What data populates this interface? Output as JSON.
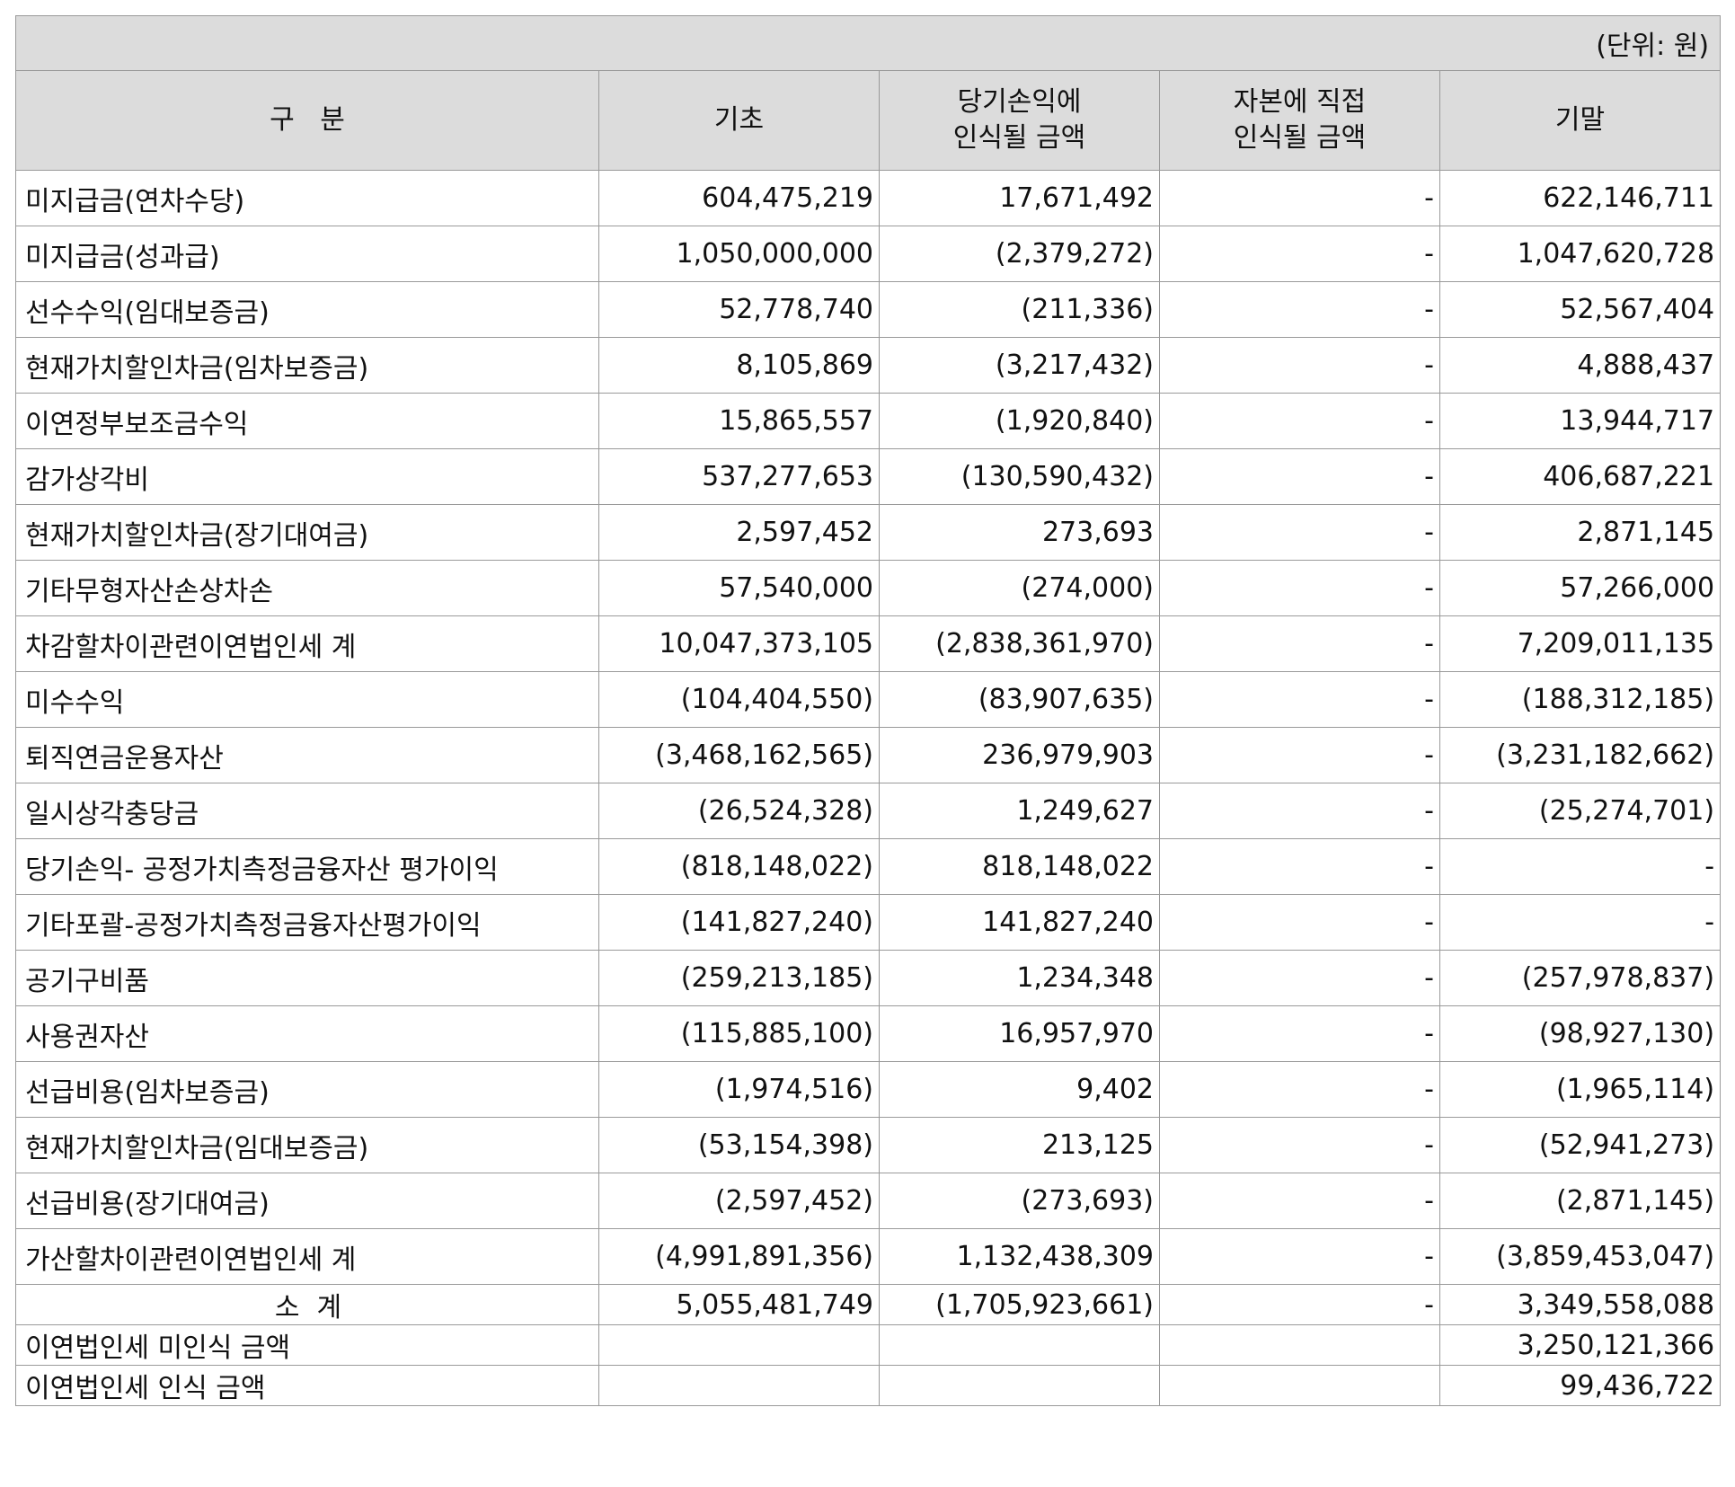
{
  "unit_label": "(단위: 원)",
  "headers": {
    "category": "구   분",
    "beginning": "기초",
    "profit_loss_line1": "당기손익에",
    "profit_loss_line2": "인식될 금액",
    "equity_line1": "자본에 직접",
    "equity_line2": "인식될 금액",
    "ending": "기말"
  },
  "rows": [
    {
      "label": "미지급금(연차수당)",
      "beginning": "604,475,219",
      "profit_loss": "17,671,492",
      "equity": "-",
      "ending": "622,146,711"
    },
    {
      "label": "미지급금(성과급)",
      "beginning": "1,050,000,000",
      "profit_loss": "(2,379,272)",
      "equity": "-",
      "ending": "1,047,620,728"
    },
    {
      "label": "선수수익(임대보증금)",
      "beginning": "52,778,740",
      "profit_loss": "(211,336)",
      "equity": "-",
      "ending": "52,567,404"
    },
    {
      "label": "현재가치할인차금(임차보증금)",
      "beginning": "8,105,869",
      "profit_loss": "(3,217,432)",
      "equity": "-",
      "ending": "4,888,437"
    },
    {
      "label": "이연정부보조금수익",
      "beginning": "15,865,557",
      "profit_loss": "(1,920,840)",
      "equity": "-",
      "ending": "13,944,717"
    },
    {
      "label": "감가상각비",
      "beginning": "537,277,653",
      "profit_loss": "(130,590,432)",
      "equity": "-",
      "ending": "406,687,221"
    },
    {
      "label": "현재가치할인차금(장기대여금)",
      "beginning": "2,597,452",
      "profit_loss": "273,693",
      "equity": "-",
      "ending": "2,871,145"
    },
    {
      "label": "기타무형자산손상차손",
      "beginning": "57,540,000",
      "profit_loss": "(274,000)",
      "equity": "-",
      "ending": "57,266,000"
    },
    {
      "label": "차감할차이관련이연법인세 계",
      "beginning": "10,047,373,105",
      "profit_loss": "(2,838,361,970)",
      "equity": "-",
      "ending": "7,209,011,135"
    },
    {
      "label": "미수수익",
      "beginning": "(104,404,550)",
      "profit_loss": "(83,907,635)",
      "equity": "-",
      "ending": "(188,312,185)"
    },
    {
      "label": "퇴직연금운용자산",
      "beginning": "(3,468,162,565)",
      "profit_loss": "236,979,903",
      "equity": "-",
      "ending": "(3,231,182,662)"
    },
    {
      "label": "일시상각충당금",
      "beginning": "(26,524,328)",
      "profit_loss": "1,249,627",
      "equity": "-",
      "ending": "(25,274,701)"
    },
    {
      "label": "당기손익- 공정가치측정금융자산 평가이익",
      "beginning": "(818,148,022)",
      "profit_loss": "818,148,022",
      "equity": "-",
      "ending": "-"
    },
    {
      "label": "기타포괄-공정가치측정금융자산평가이익",
      "beginning": "(141,827,240)",
      "profit_loss": "141,827,240",
      "equity": "-",
      "ending": "-"
    },
    {
      "label": "공기구비품",
      "beginning": "(259,213,185)",
      "profit_loss": "1,234,348",
      "equity": "-",
      "ending": "(257,978,837)"
    },
    {
      "label": "사용권자산",
      "beginning": "(115,885,100)",
      "profit_loss": "16,957,970",
      "equity": "-",
      "ending": "(98,927,130)"
    },
    {
      "label": "선급비용(임차보증금)",
      "beginning": "(1,974,516)",
      "profit_loss": "9,402",
      "equity": "-",
      "ending": "(1,965,114)"
    },
    {
      "label": "현재가치할인차금(임대보증금)",
      "beginning": "(53,154,398)",
      "profit_loss": "213,125",
      "equity": "-",
      "ending": "(52,941,273)"
    },
    {
      "label": "선급비용(장기대여금)",
      "beginning": "(2,597,452)",
      "profit_loss": "(273,693)",
      "equity": "-",
      "ending": "(2,871,145)"
    },
    {
      "label": "가산할차이관련이연법인세 계",
      "beginning": "(4,991,891,356)",
      "profit_loss": "1,132,438,309",
      "equity": "-",
      "ending": "(3,859,453,047)"
    }
  ],
  "subtotal": {
    "label": "소  계",
    "beginning": "5,055,481,749",
    "profit_loss": "(1,705,923,661)",
    "equity": "-",
    "ending": "3,349,558,088"
  },
  "unrecognized": {
    "label": "이연법인세 미인식 금액",
    "ending": "3,250,121,366"
  },
  "recognized": {
    "label": "이연법인세 인식 금액",
    "ending": "99,436,722"
  }
}
